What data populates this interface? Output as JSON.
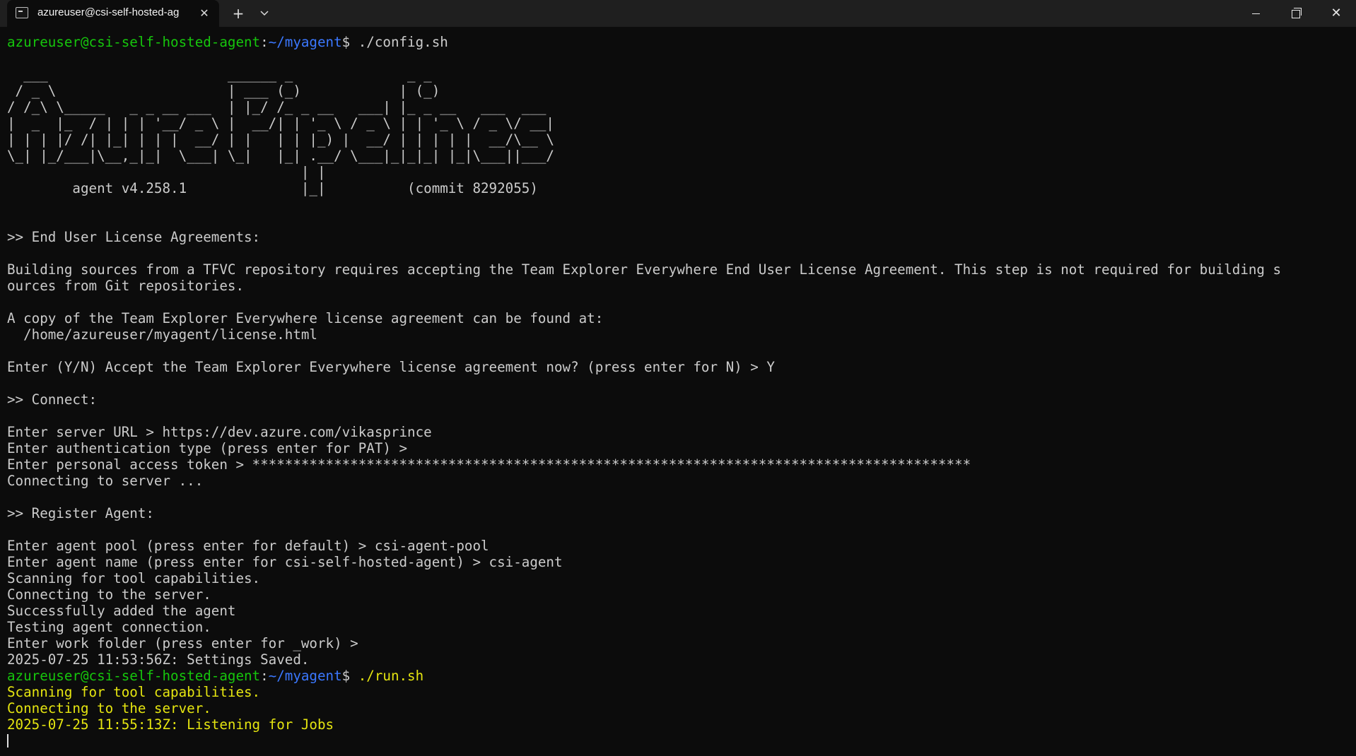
{
  "window": {
    "tab_title": "azureuser@csi-self-hosted-ag",
    "tab_icon": "terminal-icon",
    "close_tab_glyph": "✕",
    "new_tab_glyph": "+",
    "dropdown_glyph": "⌄",
    "minimize_icon": "minimize-icon",
    "maximize_icon": "restore-icon",
    "close_glyph": "✕"
  },
  "colors": {
    "background": "#0c0c0c",
    "text": "#cccccc",
    "prompt_user": "#16c60c",
    "prompt_path": "#3b78ff",
    "highlight_yellow": "#e5e510"
  },
  "terminal": {
    "prompt1": {
      "user": "azureuser@csi-self-hosted-agent",
      "sep": ":",
      "path": "~/myagent",
      "dollar": "$ ",
      "cmd": "./config.sh"
    },
    "banner": [
      "  ___                      ______ _              _ _",
      " / _ \\                     | ___ (_)            | (_)",
      "/ /_\\ \\_____   _ _ __ ___  | |_/ /_ _ __   ___| |_ _ __   ___  ___",
      "|  _  |_  / | | | '__/ _ \\ |  __/| | '_ \\ / _ \\ | | '_ \\ / _ \\/ __|",
      "| | | |/ /| |_| | | |  __/ | |   | | |_) |  __/ | | | | |  __/\\__ \\",
      "\\_| |_/___|\\__,_|_|  \\___| \\_|   |_| .__/ \\___|_|_|_| |_|\\___||___/",
      "                                    | |",
      "        agent v4.258.1              |_|          (commit 8292055)"
    ],
    "blank_a": "",
    "blank_b": "",
    "eula_header": ">> End User License Agreements:",
    "eula_text_1": "Building sources from a TFVC repository requires accepting the Team Explorer Everywhere End User License Agreement. This step is not required for building s",
    "eula_text_2": "ources from Git repositories.",
    "eula_copy": "A copy of the Team Explorer Everywhere license agreement can be found at:",
    "eula_path": "  /home/azureuser/myagent/license.html",
    "eula_prompt": "Enter (Y/N) Accept the Team Explorer Everywhere license agreement now? (press enter for N) > Y",
    "connect_header": ">> Connect:",
    "server_url": "Enter server URL > https://dev.azure.com/vikasprince",
    "auth_type": "Enter authentication type (press enter for PAT) >",
    "pat": "Enter personal access token > ****************************************************************************************",
    "connecting": "Connecting to server ...",
    "register_header": ">> Register Agent:",
    "agent_pool": "Enter agent pool (press enter for default) > csi-agent-pool",
    "agent_name": "Enter agent name (press enter for csi-self-hosted-agent) > csi-agent",
    "scanning": "Scanning for tool capabilities.",
    "connecting_server": "Connecting to the server.",
    "added": "Successfully added the agent",
    "testing": "Testing agent connection.",
    "work_folder": "Enter work folder (press enter for _work) >",
    "saved": "2025-07-25 11:53:56Z: Settings Saved.",
    "prompt2": {
      "user": "azureuser@csi-self-hosted-agent",
      "sep": ":",
      "path": "~/myagent",
      "dollar": "$ ",
      "cmd": "./run.sh"
    },
    "run_scanning": "Scanning for tool capabilities.",
    "run_connecting": "Connecting to the server.",
    "run_listening": "2025-07-25 11:55:13Z: Listening for Jobs"
  }
}
